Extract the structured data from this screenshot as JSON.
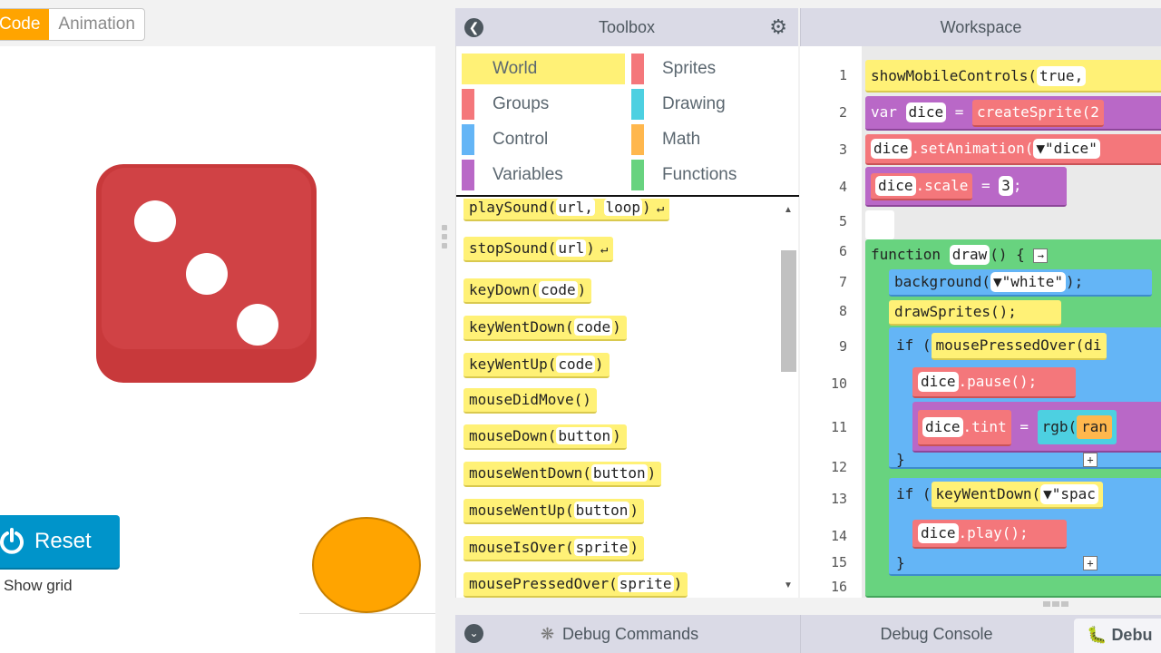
{
  "mode_toggle": {
    "code_label": "Code",
    "animation_label": "Animation"
  },
  "stage_controls": {
    "reset_label": "Reset",
    "show_grid_label": "Show grid"
  },
  "colors": {
    "orange": "#ffa400",
    "reset_blue": "#0094ca",
    "dice_red": "#c8393b",
    "header_bg": "#dadae6"
  },
  "toolbox": {
    "title": "Toolbox",
    "categories": [
      {
        "label": "World",
        "color": "#fff176"
      },
      {
        "label": "Sprites",
        "color": "#f4777b"
      },
      {
        "label": "Groups",
        "color": "#f4777b"
      },
      {
        "label": "Drawing",
        "color": "#4dd0e1"
      },
      {
        "label": "Control",
        "color": "#64b5f6"
      },
      {
        "label": "Math",
        "color": "#ffb74d"
      },
      {
        "label": "Variables",
        "color": "#b968c7"
      },
      {
        "label": "Functions",
        "color": "#68d37f"
      }
    ],
    "blocks": [
      {
        "name": "playSound",
        "args": [
          "url,",
          "loop"
        ],
        "ret": true
      },
      {
        "name": "stopSound",
        "args": [
          "url"
        ],
        "ret": true
      },
      {
        "name": "keyDown",
        "args": [
          "code"
        ]
      },
      {
        "name": "keyWentDown",
        "args": [
          "code"
        ]
      },
      {
        "name": "keyWentUp",
        "args": [
          "code"
        ]
      },
      {
        "name": "mouseDidMove",
        "args": []
      },
      {
        "name": "mouseDown",
        "args": [
          "button"
        ]
      },
      {
        "name": "mouseWentDown",
        "args": [
          "button"
        ]
      },
      {
        "name": "mouseWentUp",
        "args": [
          "button"
        ]
      },
      {
        "name": "mouseIsOver",
        "args": [
          "sprite"
        ]
      },
      {
        "name": "mousePressedOver",
        "args": [
          "sprite"
        ]
      }
    ]
  },
  "workspace": {
    "title": "Workspace",
    "line_numbers": [
      "1",
      "2",
      "3",
      "4",
      "5",
      "6",
      "7",
      "8",
      "9",
      "10",
      "11",
      "12",
      "13",
      "14",
      "15",
      "16"
    ],
    "code": {
      "l1": "showMobileControls(",
      "l1_arg": "true,",
      "l2_var": "var",
      "l2_name": "dice",
      "l2_eq": "=",
      "l2_call": "createSprite(2",
      "l3_obj": "dice",
      "l3_call": ".setAnimation(",
      "l3_arg": "▼\"dice\"",
      "l4_obj": "dice",
      "l4_prop": ".scale",
      "l4_eq": "=",
      "l4_val": "3",
      "l4_end": ";",
      "l6_fn": "function",
      "l6_name": "draw",
      "l6_rest": "() {",
      "l7": "background(",
      "l7_arg": "▼\"white\"",
      "l7_end": ");",
      "l8": "drawSprites();",
      "l9_if": "if (",
      "l9_cond": "mousePressedOver(di",
      "l10_obj": "dice",
      "l10_call": ".pause();",
      "l11_obj": "dice",
      "l11_prop": ".tint",
      "l11_eq": "=",
      "l11_fn": "rgb(",
      "l11_arg": "ran",
      "l12": "}",
      "l13_if": "if (",
      "l13_cond": "keyWentDown(",
      "l13_arg": "▼\"spac",
      "l14_obj": "dice",
      "l14_call": ".play();",
      "l15": "}"
    }
  },
  "debug": {
    "commands_label": "Debug Commands",
    "console_label": "Debug Console",
    "tab_label": "Debu"
  }
}
